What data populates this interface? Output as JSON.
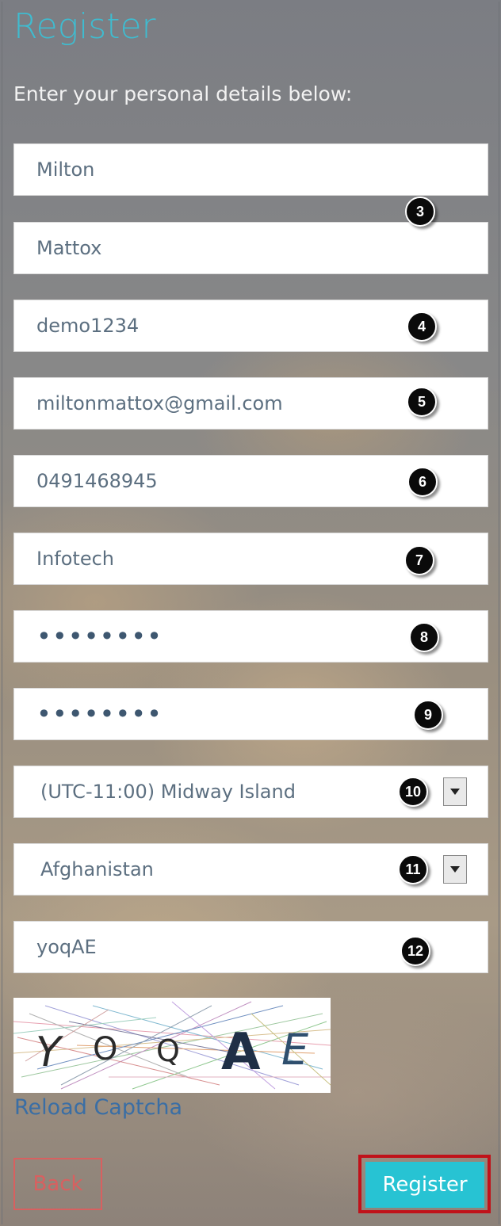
{
  "form": {
    "title": "Register",
    "subtitle": "Enter your personal details below:",
    "first_name_value": "Milton",
    "last_name_value": "Mattox",
    "username_value": "demo1234",
    "email_value": "miltonmattox@gmail.com",
    "phone_value": "0491468945",
    "company_value": "Infotech",
    "password_value": "••••••••",
    "confirm_password_value": "••••••••",
    "timezone_selected": "(UTC-11:00) Midway Island",
    "country_selected": "Afghanistan",
    "captcha_input_value": "yoqAE",
    "captcha_text": [
      "Y",
      "O",
      "Q",
      "A",
      "E"
    ],
    "reload_captcha_label": "Reload Captcha",
    "back_label": "Back",
    "register_label": "Register"
  },
  "annotations": {
    "markers": [
      "3",
      "4",
      "5",
      "6",
      "7",
      "8",
      "9",
      "10",
      "11",
      "12"
    ]
  },
  "colors": {
    "title": "#3fbcd0",
    "register_button": "#27c3d3",
    "back_button": "#d86060",
    "highlight_outline": "#c0121a",
    "link": "#3a6ea5"
  }
}
